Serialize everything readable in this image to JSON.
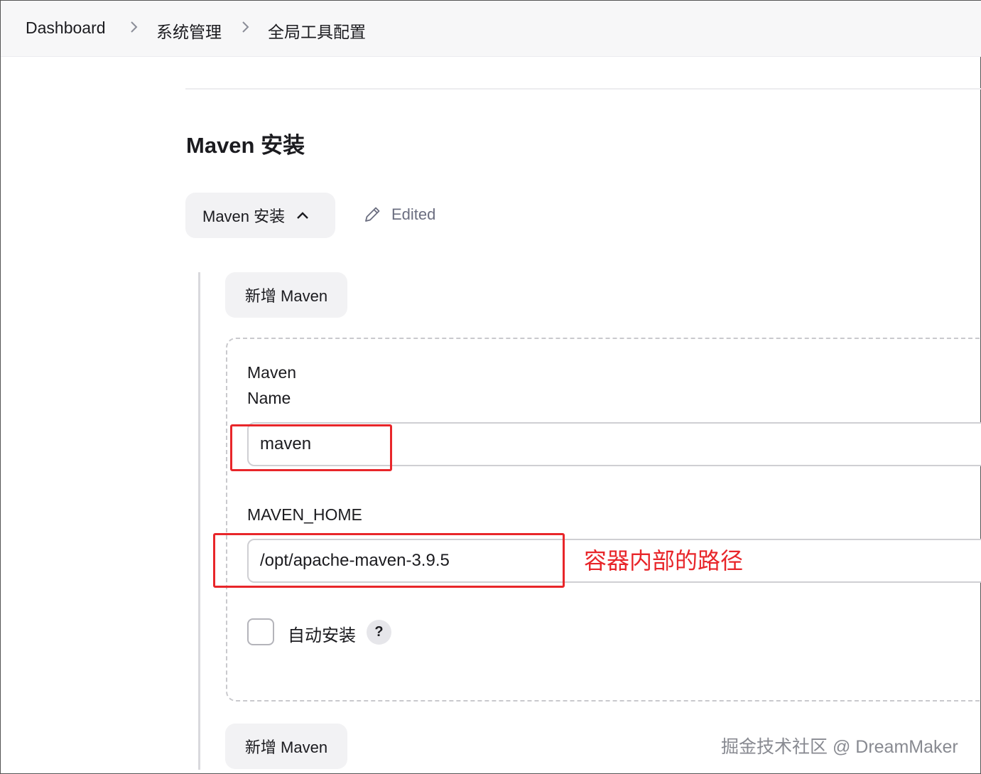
{
  "breadcrumb": {
    "items": [
      "Dashboard",
      "系统管理",
      "全局工具配置"
    ]
  },
  "section": {
    "title": "Maven 安装",
    "toggle_label": "Maven 安装",
    "edited_label": "Edited"
  },
  "add_button_label": "新增 Maven",
  "maven": {
    "name_label_line1": "Maven",
    "name_label_line2": "Name",
    "name_value": "maven",
    "home_label": "MAVEN_HOME",
    "home_value": "/opt/apache-maven-3.9.5",
    "auto_install_label": "自动安装",
    "auto_install_checked": false,
    "help_label": "?"
  },
  "annotation": {
    "text": "容器内部的路径",
    "color": "#e8262a"
  },
  "watermark": "掘金技术社区 @ DreamMaker",
  "icons": {
    "breadcrumb_separator": "chevron-right-icon",
    "toggle": "chevron-up-icon",
    "edited": "pencil-icon"
  },
  "colors": {
    "accent_red": "#e8262a",
    "pill_bg": "#f2f2f4",
    "muted_text": "#6b6e80"
  }
}
